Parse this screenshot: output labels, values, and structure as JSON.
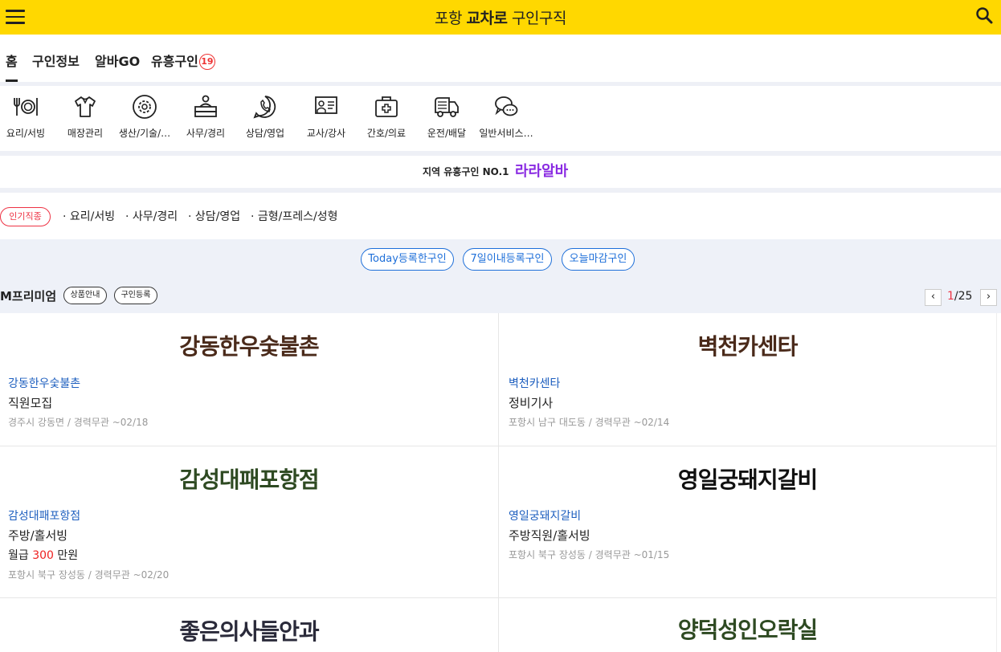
{
  "header": {
    "brand_prefix": "포항 ",
    "brand_bold": "교차로",
    "brand_suffix": " 구인구직"
  },
  "tabs": [
    {
      "label": "홈"
    },
    {
      "label": "구인정보"
    },
    {
      "label": "알바GO"
    },
    {
      "label": "유흥구인",
      "badge": "19"
    }
  ],
  "categories": [
    {
      "label": "요리/서빙",
      "icon": "dining-icon"
    },
    {
      "label": "매장관리",
      "icon": "shirt-icon"
    },
    {
      "label": "생산/기술/…",
      "icon": "gear-icon"
    },
    {
      "label": "사무/경리",
      "icon": "office-desk-icon"
    },
    {
      "label": "상담/영업",
      "icon": "phone-icon"
    },
    {
      "label": "교사/강사",
      "icon": "teacher-board-icon"
    },
    {
      "label": "간호/의료",
      "icon": "medical-kit-icon"
    },
    {
      "label": "운전/배달",
      "icon": "truck-icon"
    },
    {
      "label": "일반서비스…",
      "icon": "chat-bubbles-icon"
    }
  ],
  "banner": {
    "text": "지역 유흥구인 NO.1",
    "logo": "라라알바"
  },
  "popular": {
    "badge": "인기직종",
    "items": [
      "· 요리/서빙",
      "· 사무/경리",
      "· 상담/영업",
      "· 금형/프레스/성형"
    ]
  },
  "filters": [
    "Today등록한구인",
    "7일이내등록구인",
    "오늘마감구인"
  ],
  "premium": {
    "title": "M프리미엄",
    "info_label": "상품안내",
    "register_label": "구인등록",
    "page_current": "1",
    "page_total": "/25",
    "prev_icon": "chevron-left-icon",
    "next_icon": "chevron-right-icon"
  },
  "jobs": [
    {
      "logo": "강동한우숯불촌",
      "logo_color": "#4a2a1a",
      "company": "강동한우숯불촌",
      "title": "직원모집",
      "pay_prefix": "",
      "pay_amount": "",
      "pay_suffix": "",
      "meta": "경주시 강동면 / 경력무관  ~02/18"
    },
    {
      "logo": "벽천카센타",
      "logo_color": "#4a2a1a",
      "company": "벽천카센타",
      "title": "정비기사",
      "pay_prefix": "",
      "pay_amount": "",
      "pay_suffix": "",
      "meta": "포항시 남구 대도동 / 경력무관  ~02/14"
    },
    {
      "logo": "감성대패포항점",
      "logo_color": "#2e4a22",
      "company": "감성대패포항점",
      "title": "주방/홀서빙",
      "pay_prefix": "월급 ",
      "pay_amount": "300",
      "pay_suffix": " 만원",
      "meta": "포항시 북구 장성동 / 경력무관  ~02/20"
    },
    {
      "logo": "영일궁돼지갈비",
      "logo_color": "#111111",
      "company": "영일궁돼지갈비",
      "title": "주방직원/홀서빙",
      "pay_prefix": "",
      "pay_amount": "",
      "pay_suffix": "",
      "meta": "포항시 북구 장성동 / 경력무관  ~01/15"
    },
    {
      "logo": "좋은의사들안과",
      "logo_color": "#2a2a3a",
      "company": "",
      "title": "",
      "pay_prefix": "",
      "pay_amount": "",
      "pay_suffix": "",
      "meta": ""
    },
    {
      "logo": "양덕성인오락실",
      "logo_color": "#2e4a22",
      "company": "",
      "title": "",
      "pay_prefix": "",
      "pay_amount": "",
      "pay_suffix": "",
      "meta": ""
    }
  ]
}
